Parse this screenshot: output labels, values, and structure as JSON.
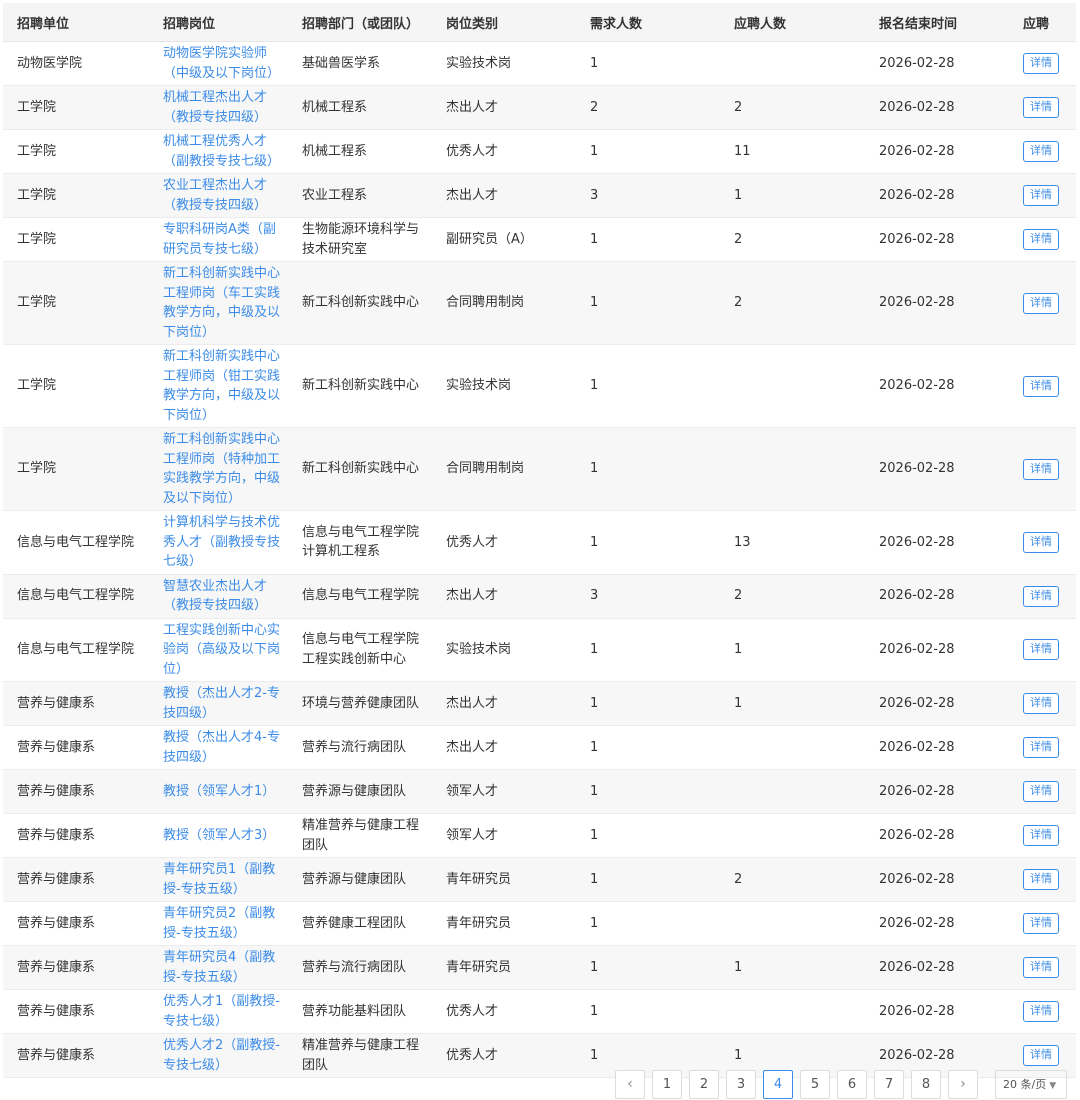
{
  "table": {
    "headers": [
      "招聘单位",
      "招聘岗位",
      "招聘部门（或团队）",
      "岗位类别",
      "需求人数",
      "应聘人数",
      "报名结束时间",
      "应聘"
    ],
    "rows": [
      {
        "unit": "动物医学院",
        "position": "动物医学院实验师（中级及以下岗位）",
        "dept": "基础兽医学系",
        "category": "实验技术岗",
        "needed": "1",
        "applicants": "",
        "deadline": "2026-02-28",
        "action": "详情"
      },
      {
        "unit": "工学院",
        "position": "机械工程杰出人才（教授专技四级）",
        "dept": "机械工程系",
        "category": "杰出人才",
        "needed": "2",
        "applicants": "2",
        "deadline": "2026-02-28",
        "action": "详情"
      },
      {
        "unit": "工学院",
        "position": "机械工程优秀人才（副教授专技七级）",
        "dept": "机械工程系",
        "category": "优秀人才",
        "needed": "1",
        "applicants": "11",
        "deadline": "2026-02-28",
        "action": "详情"
      },
      {
        "unit": "工学院",
        "position": "农业工程杰出人才（教授专技四级）",
        "dept": "农业工程系",
        "category": "杰出人才",
        "needed": "3",
        "applicants": "1",
        "deadline": "2026-02-28",
        "action": "详情"
      },
      {
        "unit": "工学院",
        "position": "专职科研岗A类（副研究员专技七级）",
        "dept": "生物能源环境科学与技术研究室",
        "category": "副研究员（A）",
        "needed": "1",
        "applicants": "2",
        "deadline": "2026-02-28",
        "action": "详情"
      },
      {
        "unit": "工学院",
        "position": "新工科创新实践中心工程师岗（车工实践教学方向，中级及以下岗位）",
        "dept": "新工科创新实践中心",
        "category": "合同聘用制岗",
        "needed": "1",
        "applicants": "2",
        "deadline": "2026-02-28",
        "action": "详情"
      },
      {
        "unit": "工学院",
        "position": "新工科创新实践中心工程师岗（钳工实践教学方向，中级及以下岗位）",
        "dept": "新工科创新实践中心",
        "category": "实验技术岗",
        "needed": "1",
        "applicants": "",
        "deadline": "2026-02-28",
        "action": "详情"
      },
      {
        "unit": "工学院",
        "position": "新工科创新实践中心工程师岗（特种加工实践教学方向，中级及以下岗位）",
        "dept": "新工科创新实践中心",
        "category": "合同聘用制岗",
        "needed": "1",
        "applicants": "",
        "deadline": "2026-02-28",
        "action": "详情"
      },
      {
        "unit": "信息与电气工程学院",
        "position": "计算机科学与技术优秀人才（副教授专技七级）",
        "dept": "信息与电气工程学院计算机工程系",
        "category": "优秀人才",
        "needed": "1",
        "applicants": "13",
        "deadline": "2026-02-28",
        "action": "详情"
      },
      {
        "unit": "信息与电气工程学院",
        "position": "智慧农业杰出人才（教授专技四级）",
        "dept": "信息与电气工程学院",
        "category": "杰出人才",
        "needed": "3",
        "applicants": "2",
        "deadline": "2026-02-28",
        "action": "详情"
      },
      {
        "unit": "信息与电气工程学院",
        "position": "工程实践创新中心实验岗（高级及以下岗位）",
        "dept": "信息与电气工程学院工程实践创新中心",
        "category": "实验技术岗",
        "needed": "1",
        "applicants": "1",
        "deadline": "2026-02-28",
        "action": "详情"
      },
      {
        "unit": "营养与健康系",
        "position": "教授（杰出人才2-专技四级）",
        "dept": "环境与营养健康团队",
        "category": "杰出人才",
        "needed": "1",
        "applicants": "1",
        "deadline": "2026-02-28",
        "action": "详情"
      },
      {
        "unit": "营养与健康系",
        "position": "教授（杰出人才4-专技四级）",
        "dept": "营养与流行病团队",
        "category": "杰出人才",
        "needed": "1",
        "applicants": "",
        "deadline": "2026-02-28",
        "action": "详情"
      },
      {
        "unit": "营养与健康系",
        "position": "教授（领军人才1）",
        "dept": "营养源与健康团队",
        "category": "领军人才",
        "needed": "1",
        "applicants": "",
        "deadline": "2026-02-28",
        "action": "详情"
      },
      {
        "unit": "营养与健康系",
        "position": "教授（领军人才3）",
        "dept": "精准营养与健康工程团队",
        "category": "领军人才",
        "needed": "1",
        "applicants": "",
        "deadline": "2026-02-28",
        "action": "详情"
      },
      {
        "unit": "营养与健康系",
        "position": "青年研究员1（副教授-专技五级）",
        "dept": "营养源与健康团队",
        "category": "青年研究员",
        "needed": "1",
        "applicants": "2",
        "deadline": "2026-02-28",
        "action": "详情"
      },
      {
        "unit": "营养与健康系",
        "position": "青年研究员2（副教授-专技五级）",
        "dept": "营养健康工程团队",
        "category": "青年研究员",
        "needed": "1",
        "applicants": "",
        "deadline": "2026-02-28",
        "action": "详情"
      },
      {
        "unit": "营养与健康系",
        "position": "青年研究员4（副教授-专技五级）",
        "dept": "营养与流行病团队",
        "category": "青年研究员",
        "needed": "1",
        "applicants": "1",
        "deadline": "2026-02-28",
        "action": "详情"
      },
      {
        "unit": "营养与健康系",
        "position": "优秀人才1（副教授-专技七级）",
        "dept": "营养功能基料团队",
        "category": "优秀人才",
        "needed": "1",
        "applicants": "",
        "deadline": "2026-02-28",
        "action": "详情"
      },
      {
        "unit": "营养与健康系",
        "position": "优秀人才2（副教授-专技七级）",
        "dept": "精准营养与健康工程团队",
        "category": "优秀人才",
        "needed": "1",
        "applicants": "1",
        "deadline": "2026-02-28",
        "action": "详情"
      }
    ]
  },
  "pagination": {
    "prev_icon": "chevron-left-icon",
    "next_icon": "chevron-right-icon",
    "pages": [
      "1",
      "2",
      "3",
      "4",
      "5",
      "6",
      "7",
      "8"
    ],
    "current_page": "4",
    "page_size": "20 条/页",
    "accent_color": "#3c8ce7"
  }
}
